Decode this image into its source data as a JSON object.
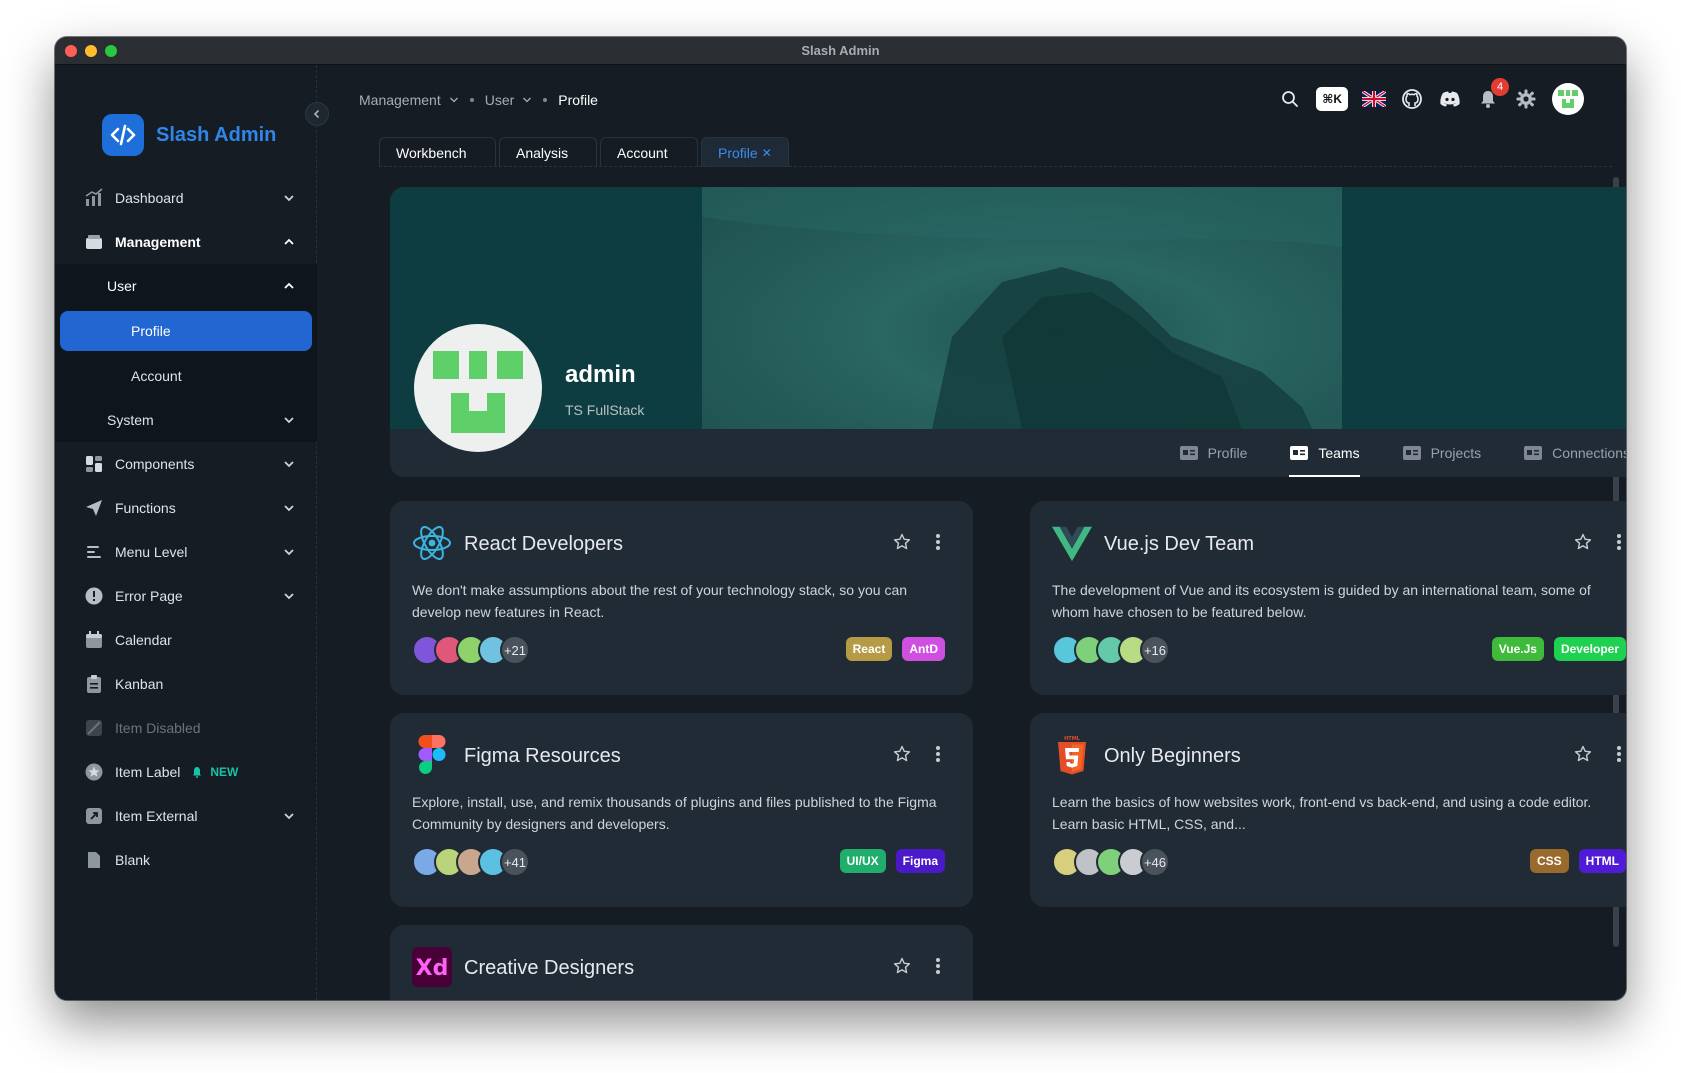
{
  "window": {
    "title": "Slash Admin"
  },
  "brand": {
    "name": "Slash Admin"
  },
  "sidebar": {
    "items": [
      {
        "label": "Dashboard",
        "icon": "chart-icon"
      },
      {
        "label": "Management",
        "icon": "box-icon"
      },
      {
        "label": "User"
      },
      {
        "label": "Profile"
      },
      {
        "label": "Account"
      },
      {
        "label": "System"
      },
      {
        "label": "Components",
        "icon": "components-icon"
      },
      {
        "label": "Functions",
        "icon": "paper-plane-icon"
      },
      {
        "label": "Menu Level",
        "icon": "menu-icon"
      },
      {
        "label": "Error Page",
        "icon": "error-icon"
      },
      {
        "label": "Calendar",
        "icon": "calendar-icon"
      },
      {
        "label": "Kanban",
        "icon": "clipboard-icon"
      },
      {
        "label": "Item Disabled",
        "icon": "disabled-icon"
      },
      {
        "label": "Item Label",
        "icon": "star-icon",
        "badge": "NEW"
      },
      {
        "label": "Item External",
        "icon": "external-link-icon"
      },
      {
        "label": "Blank",
        "icon": "file-icon"
      }
    ]
  },
  "breadcrumb": {
    "level1": "Management",
    "level2": "User",
    "current": "Profile"
  },
  "header": {
    "shortcut": "⌘K",
    "notifications": "4"
  },
  "tabs": {
    "workbench": "Workbench",
    "analysis": "Analysis",
    "account": "Account",
    "profile": "Profile"
  },
  "profile": {
    "name": "admin",
    "role": "TS FullStack",
    "tabs": [
      "Profile",
      "Teams",
      "Projects",
      "Connections"
    ],
    "active_tab": "Teams"
  },
  "teams": [
    {
      "name": "React Developers",
      "desc": "We don't make assumptions about the rest of your technology stack, so you can develop new features in React.",
      "extra": "+21",
      "tags": [
        {
          "label": "React",
          "color": "#b59b46"
        },
        {
          "label": "AntD",
          "color": "#cf4fe0"
        }
      ]
    },
    {
      "name": "Vue.js Dev Team",
      "desc": "The development of Vue and its ecosystem is guided by an international team, some of whom have chosen to be featured below.",
      "extra": "+16",
      "tags": [
        {
          "label": "Vue.Js",
          "color": "#3fba3b"
        },
        {
          "label": "Developer",
          "color": "#1fd150"
        }
      ]
    },
    {
      "name": "Figma Resources",
      "desc": "Explore, install, use, and remix thousands of plugins and files published to the Figma Community by designers and developers.",
      "extra": "+41",
      "tags": [
        {
          "label": "UI/UX",
          "color": "#1fae6c"
        },
        {
          "label": "Figma",
          "color": "#4a19c9"
        }
      ]
    },
    {
      "name": "Only Beginners",
      "desc": "Learn the basics of how websites work, front-end vs back-end, and using a code editor. Learn basic HTML, CSS, and...",
      "extra": "+46",
      "tags": [
        {
          "label": "CSS",
          "color": "#9a6a2c"
        },
        {
          "label": "HTML",
          "color": "#4f1bd6"
        }
      ]
    },
    {
      "name": "Creative Designers",
      "desc": "",
      "extra": "",
      "tags": []
    }
  ],
  "colors": {
    "accent": "#2166d1",
    "bg": "#161c24",
    "card": "#212b36"
  }
}
